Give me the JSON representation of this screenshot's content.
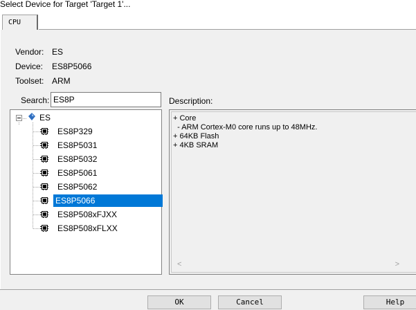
{
  "window": {
    "title": "Select Device for Target 'Target 1'..."
  },
  "tabs": [
    {
      "label": "CPU"
    }
  ],
  "info": {
    "vendor_label": "Vendor:",
    "vendor_value": "ES",
    "device_label": "Device:",
    "device_value": "ES8P5066",
    "toolset_label": "Toolset:",
    "toolset_value": "ARM"
  },
  "search": {
    "label": "Search:",
    "value": "ES8P"
  },
  "description": {
    "label": "Description:",
    "lines": [
      "+ Core",
      "  - ARM Cortex-M0 core runs up to 48MHz.",
      "+ 64KB Flash",
      "+ 4KB SRAM"
    ]
  },
  "tree": {
    "root_label": "ES",
    "devices": [
      "ES8P329",
      "ES8P5031",
      "ES8P5032",
      "ES8P5061",
      "ES8P5062",
      "ES8P5066",
      "ES8P508xFJXX",
      "ES8P508xFLXX"
    ],
    "selected": "ES8P5066"
  },
  "buttons": {
    "ok": "OK",
    "cancel": "Cancel",
    "help": "Help"
  }
}
